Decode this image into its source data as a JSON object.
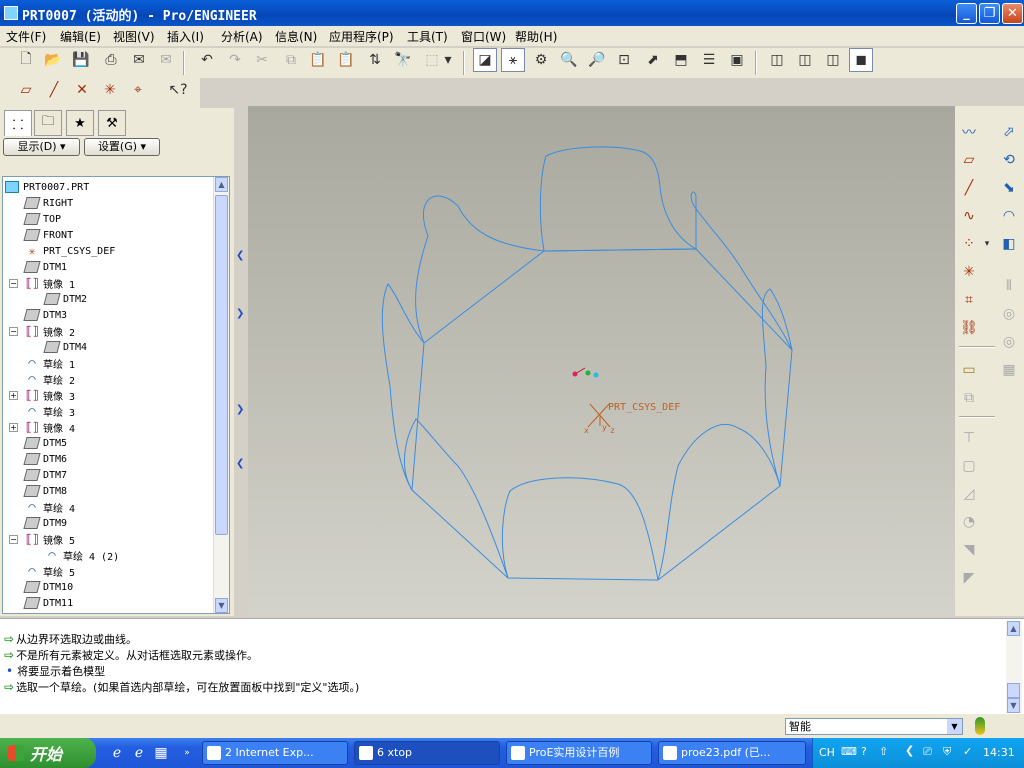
{
  "window": {
    "title": "PRT0007 (活动的) - Pro/ENGINEER",
    "minimize": "_",
    "maximize": "❐",
    "close": "✕"
  },
  "menu": [
    "文件(F)",
    "编辑(E)",
    "视图(V)",
    "插入(I)",
    "分析(A)",
    "信息(N)",
    "应用程序(P)",
    "工具(T)",
    "窗口(W)",
    "帮助(H)"
  ],
  "panel": {
    "display_button": "显示(D) ▾",
    "settings_button": "设置(G) ▾"
  },
  "tree": [
    {
      "label": "PRT0007.PRT",
      "type": "part",
      "level": 0
    },
    {
      "label": "RIGHT",
      "type": "plane",
      "level": 1
    },
    {
      "label": "TOP",
      "type": "plane",
      "level": 1
    },
    {
      "label": "FRONT",
      "type": "plane",
      "level": 1
    },
    {
      "label": "PRT_CSYS_DEF",
      "type": "csys",
      "level": 1
    },
    {
      "label": "DTM1",
      "type": "plane",
      "level": 1
    },
    {
      "label": "镜像 1",
      "type": "mirror",
      "level": 1,
      "expander": "−"
    },
    {
      "label": "DTM2",
      "type": "plane",
      "level": 2
    },
    {
      "label": "DTM3",
      "type": "plane",
      "level": 1
    },
    {
      "label": "镜像 2",
      "type": "mirror",
      "level": 1,
      "expander": "−"
    },
    {
      "label": "DTM4",
      "type": "plane",
      "level": 2
    },
    {
      "label": "草绘 1",
      "type": "sketch",
      "level": 1
    },
    {
      "label": "草绘 2",
      "type": "sketch",
      "level": 1
    },
    {
      "label": "镜像 3",
      "type": "mirror",
      "level": 1,
      "expander": "+"
    },
    {
      "label": "草绘 3",
      "type": "sketch",
      "level": 1
    },
    {
      "label": "镜像 4",
      "type": "mirror",
      "level": 1,
      "expander": "+"
    },
    {
      "label": "DTM5",
      "type": "plane",
      "level": 1
    },
    {
      "label": "DTM6",
      "type": "plane",
      "level": 1
    },
    {
      "label": "DTM7",
      "type": "plane",
      "level": 1
    },
    {
      "label": "DTM8",
      "type": "plane",
      "level": 1
    },
    {
      "label": "草绘 4",
      "type": "sketch",
      "level": 1
    },
    {
      "label": "DTM9",
      "type": "plane",
      "level": 1
    },
    {
      "label": "镜像 5",
      "type": "mirror",
      "level": 1,
      "expander": "−"
    },
    {
      "label": "草绘 4 (2)",
      "type": "sketch",
      "level": 2
    },
    {
      "label": "草绘 5",
      "type": "sketch",
      "level": 1
    },
    {
      "label": "DTM10",
      "type": "plane",
      "level": 1
    },
    {
      "label": "DTM11",
      "type": "plane",
      "level": 1
    }
  ],
  "graphics": {
    "csys_label": "PRT_CSYS_DEF",
    "axis_x": "x",
    "axis_y": "y",
    "axis_z": "z",
    "curve_color": "#3a8ce0",
    "csys_color": "#c06020"
  },
  "messages": [
    {
      "icon": "arrow",
      "text": "从边界环选取边或曲线。"
    },
    {
      "icon": "arrow",
      "text": "不是所有元素被定义。从对话框选取元素或操作。"
    },
    {
      "icon": "dot",
      "text": "将要显示着色模型"
    },
    {
      "icon": "arrow",
      "text": "选取一个草绘。(如果首选内部草绘，可在放置面板中找到\"定义\"选项。)"
    }
  ],
  "status": {
    "filter_value": "智能"
  },
  "taskbar": {
    "start": "开始",
    "tasks": [
      {
        "label": "2 Internet Exp...",
        "active": false
      },
      {
        "label": "6 xtop",
        "active": true
      },
      {
        "label": "ProE实用设计百例",
        "active": false
      },
      {
        "label": "proe23.pdf (已...",
        "active": false
      }
    ],
    "lang": "CH",
    "clock": "14:31"
  }
}
